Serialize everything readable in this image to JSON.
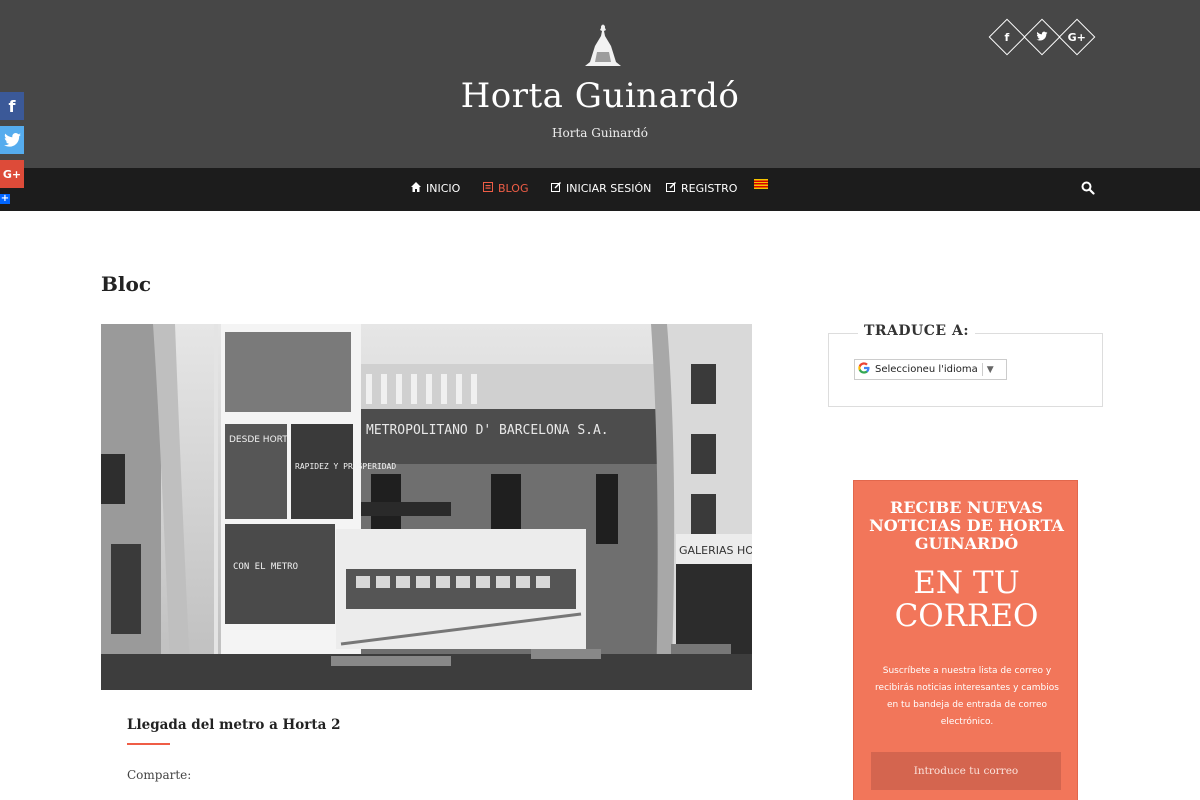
{
  "header": {
    "site_title": "Horta Guinardó",
    "tagline": "Horta Guinardó",
    "social": [
      {
        "icon": "facebook-icon",
        "glyph": "f"
      },
      {
        "icon": "twitter-icon",
        "glyph": "🐦"
      },
      {
        "icon": "google-plus-icon",
        "glyph": "G+"
      }
    ]
  },
  "floating_share": {
    "facebook": "f",
    "twitter": "t",
    "google_plus": "G+",
    "more": "+"
  },
  "nav": {
    "items": [
      {
        "label": "INICIO",
        "icon": "home-icon"
      },
      {
        "label": "BLOG",
        "icon": "blog-icon",
        "active": true
      },
      {
        "label": "INICIAR SESIÓN",
        "icon": "edit-icon"
      },
      {
        "label": "REGISTRO",
        "icon": "edit-icon"
      }
    ],
    "language_flag": "catalan-flag",
    "search": "search-icon"
  },
  "main": {
    "page_heading": "Bloc",
    "post": {
      "title": "Llegada del metro a Horta 2",
      "share_label": "Comparte:"
    },
    "image_texts": {
      "building_sign": "METROPOLITANO D' BARCELONA S.A.",
      "poster_1": "DESDE HORTA",
      "poster_2": "RAPIDEZ Y PROSPERIDAD",
      "poster_3": "CON EL METRO",
      "shop_sign": "GALERIAS HO"
    }
  },
  "sidebar": {
    "translate": {
      "title": "TRADUCE A:",
      "select_label": "Seleccioneu l'idioma",
      "arrow": "▼"
    },
    "newsletter": {
      "title": "RECIBE NUEVAS NOTICIAS DE HORTA GUINARDÓ",
      "big": "EN TU CORREO",
      "text": "Suscríbete a nuestra lista de correo y recibirás noticias interesantes y cambios en tu bandeja de entrada de correo electrónico.",
      "input_placeholder": "Introduce tu correo"
    }
  },
  "colors": {
    "header_bg": "#474747",
    "nav_bg": "#1c1c1c",
    "accent": "#ef5d46",
    "newsletter_bg": "#f2765a"
  }
}
